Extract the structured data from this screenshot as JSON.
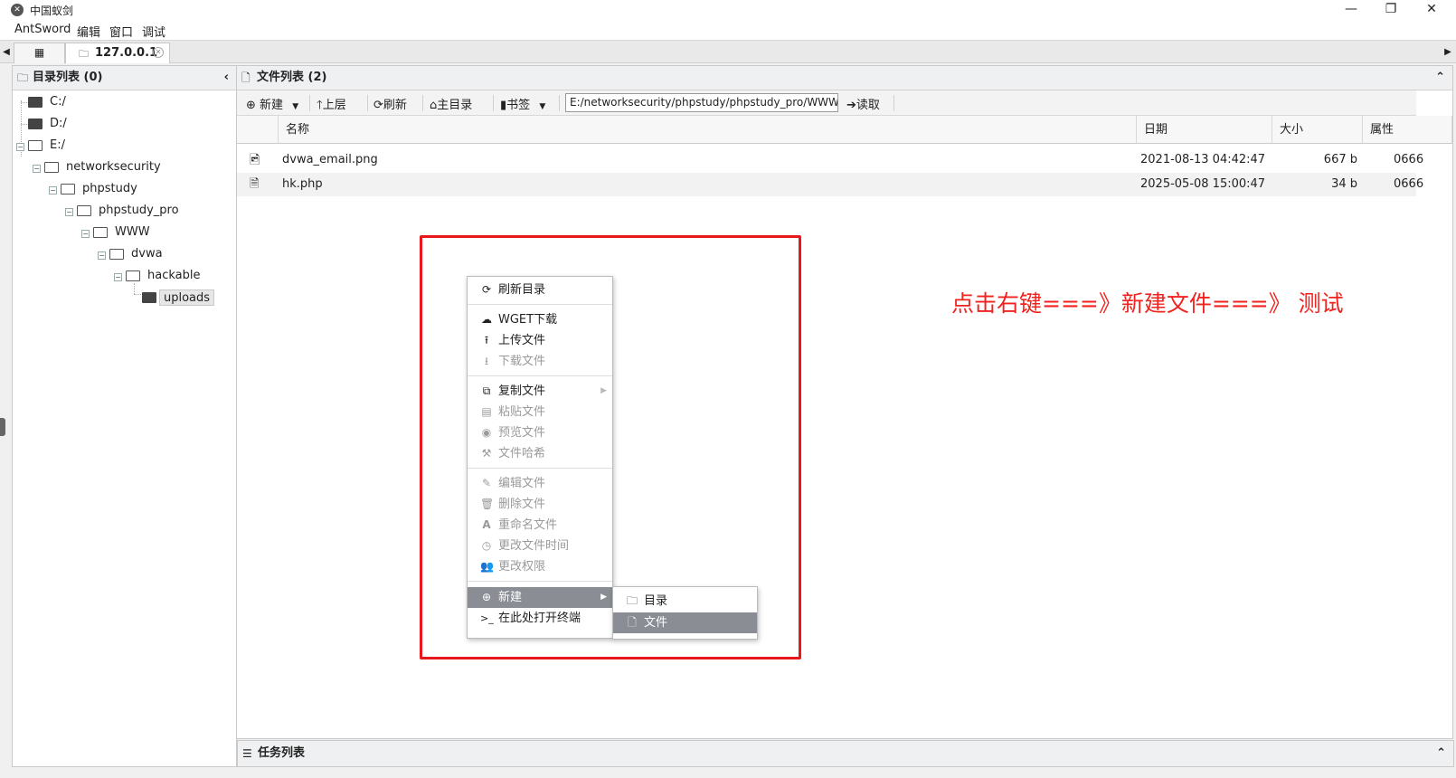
{
  "window": {
    "title": "中国蚁剑",
    "minimize_icon": "minimize-icon",
    "restore_icon": "restore-icon",
    "close_icon": "close-icon"
  },
  "menubar": {
    "items": [
      "AntSword",
      "编辑",
      "窗口",
      "调试"
    ]
  },
  "tabs": {
    "active_label": "127.0.0.1"
  },
  "left_panel": {
    "title": "目录列表 (0)",
    "tree": [
      {
        "label": "C:/",
        "depth": 0
      },
      {
        "label": "D:/",
        "depth": 0
      },
      {
        "label": "E:/",
        "depth": 0
      },
      {
        "label": "networksecurity",
        "depth": 1
      },
      {
        "label": "phpstudy",
        "depth": 2
      },
      {
        "label": "phpstudy_pro",
        "depth": 3
      },
      {
        "label": "WWW",
        "depth": 4
      },
      {
        "label": "dvwa",
        "depth": 5
      },
      {
        "label": "hackable",
        "depth": 6
      },
      {
        "label": "uploads",
        "depth": 7,
        "selected": true
      }
    ]
  },
  "file_panel": {
    "title": "文件列表 (2)",
    "toolbar": {
      "new_label": "新建",
      "up_label": "上层",
      "refresh_label": "刷新",
      "home_label": "主目录",
      "bookmark_label": "书签",
      "path_value": "E:/networksecurity/phpstudy/phpstudy_pro/WWW/dvwa/",
      "read_label": "读取"
    },
    "columns": [
      "名称",
      "日期",
      "大小",
      "属性"
    ],
    "rows": [
      {
        "name": "dvwa_email.png",
        "date": "2021-08-13 04:42:47",
        "size": "667 b",
        "perm": "0666",
        "icon": "image-file-icon"
      },
      {
        "name": "hk.php",
        "date": "2025-05-08 15:00:47",
        "size": "34 b",
        "perm": "0666",
        "icon": "code-file-icon"
      }
    ]
  },
  "context_menu": {
    "items": [
      {
        "label": "刷新目录",
        "icon": "refresh-icon",
        "enabled": true
      },
      {
        "label": "WGET下载",
        "icon": "cloud-download-icon",
        "enabled": true
      },
      {
        "label": "上传文件",
        "icon": "upload-icon",
        "enabled": true
      },
      {
        "label": "下载文件",
        "icon": "download-icon",
        "enabled": false
      },
      {
        "label": "复制文件",
        "icon": "copy-icon",
        "enabled": true
      },
      {
        "label": "粘贴文件",
        "icon": "paste-icon",
        "enabled": false
      },
      {
        "label": "预览文件",
        "icon": "eye-icon",
        "enabled": false
      },
      {
        "label": "文件哈希",
        "icon": "gavel-icon",
        "enabled": false
      },
      {
        "label": "编辑文件",
        "icon": "edit-icon",
        "enabled": false
      },
      {
        "label": "删除文件",
        "icon": "trash-icon",
        "enabled": false
      },
      {
        "label": "重命名文件",
        "icon": "font-icon",
        "enabled": false
      },
      {
        "label": "更改文件时间",
        "icon": "clock-icon",
        "enabled": false
      },
      {
        "label": "更改权限",
        "icon": "users-icon",
        "enabled": false
      },
      {
        "label": "新建",
        "icon": "plus-circle-icon",
        "enabled": true,
        "selected": true
      },
      {
        "label": "在此处打开终端",
        "icon": "terminal-icon",
        "enabled": true
      }
    ],
    "submenu": [
      {
        "label": "目录",
        "icon": "folder-icon"
      },
      {
        "label": "文件",
        "icon": "file-icon",
        "selected": true
      }
    ]
  },
  "task_panel": {
    "title": "任务列表"
  },
  "annotation": {
    "text": "点击右键===》新建文件===》 测试",
    "color": "#f0231f"
  },
  "colors": {
    "highlight_border": "#e8171b",
    "menu_selected": "#8a8e94"
  }
}
